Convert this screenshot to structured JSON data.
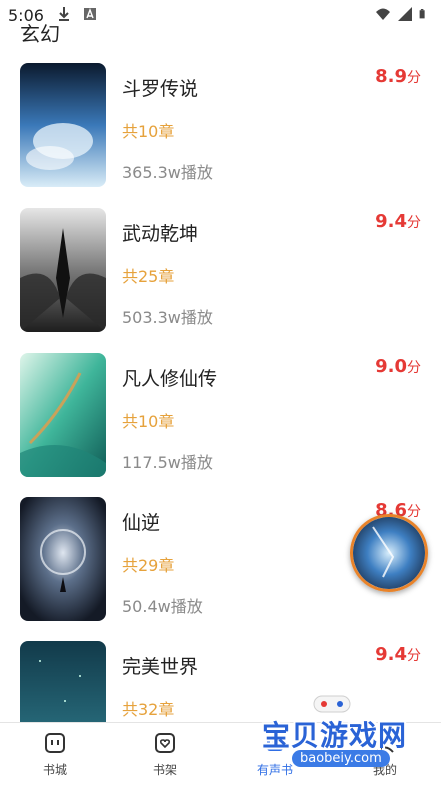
{
  "status_bar": {
    "time": "5:06",
    "icons_left": [
      "download-icon",
      "font-icon"
    ],
    "icons_right": [
      "wifi-icon",
      "signal-icon",
      "battery-icon"
    ]
  },
  "category": {
    "title": "玄幻"
  },
  "books": [
    {
      "title": "斗罗传说",
      "chapters": "共10章",
      "plays": "365.3w播放",
      "score": "8.9",
      "score_unit": "分"
    },
    {
      "title": "武动乾坤",
      "chapters": "共25章",
      "plays": "503.3w播放",
      "score": "9.4",
      "score_unit": "分"
    },
    {
      "title": "凡人修仙传",
      "chapters": "共10章",
      "plays": "117.5w播放",
      "score": "9.0",
      "score_unit": "分"
    },
    {
      "title": "仙逆",
      "chapters": "共29章",
      "plays": "50.4w播放",
      "score": "8.6",
      "score_unit": "分"
    },
    {
      "title": "完美世界",
      "chapters": "共32章",
      "plays": "",
      "score": "9.4",
      "score_unit": "分"
    }
  ],
  "bottom_nav": [
    {
      "label": "书城",
      "icon": "bookstore-icon",
      "active": false
    },
    {
      "label": "书架",
      "icon": "bookshelf-icon",
      "active": false
    },
    {
      "label": "有声书",
      "icon": "audiobook-icon",
      "active": true
    },
    {
      "label": "我的",
      "icon": "profile-icon",
      "active": false
    }
  ],
  "watermark": {
    "text": "宝贝游戏网",
    "url": "baobeiy.com"
  },
  "colors": {
    "score": "#e53935",
    "chapters": "#e6a23c",
    "plays": "#8a8a8a",
    "active_nav": "#2f6ee5",
    "player_ring": "#e8832a"
  }
}
